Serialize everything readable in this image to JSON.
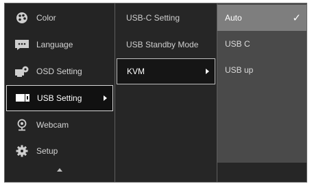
{
  "main_menu": {
    "items": [
      {
        "label": "Color",
        "icon": "color-palette-icon"
      },
      {
        "label": "Language",
        "icon": "language-speech-icon"
      },
      {
        "label": "OSD Setting",
        "icon": "osd-gear-icon"
      },
      {
        "label": "USB Setting",
        "icon": "usb-monitor-icon"
      },
      {
        "label": "Webcam",
        "icon": "webcam-icon"
      },
      {
        "label": "Setup",
        "icon": "setup-gear-icon"
      }
    ],
    "selected": "USB Setting",
    "scroll_indicator": "up-arrow-icon"
  },
  "sub_menu": {
    "items": [
      {
        "label": "USB-C Setting"
      },
      {
        "label": "USB Standby Mode"
      },
      {
        "label": "KVM"
      }
    ],
    "selected": "KVM"
  },
  "options": {
    "items": [
      {
        "label": "Auto"
      },
      {
        "label": "USB C"
      },
      {
        "label": "USB up"
      }
    ],
    "selected": "Auto",
    "selected_mark": "✓"
  },
  "colors": {
    "panel_bg": "#232323",
    "option_panel_bg": "#4a4a4a",
    "option_selected_bg": "#7e7e7e",
    "highlight_border": "#d8d8d8",
    "text": "#d4d4d4"
  }
}
